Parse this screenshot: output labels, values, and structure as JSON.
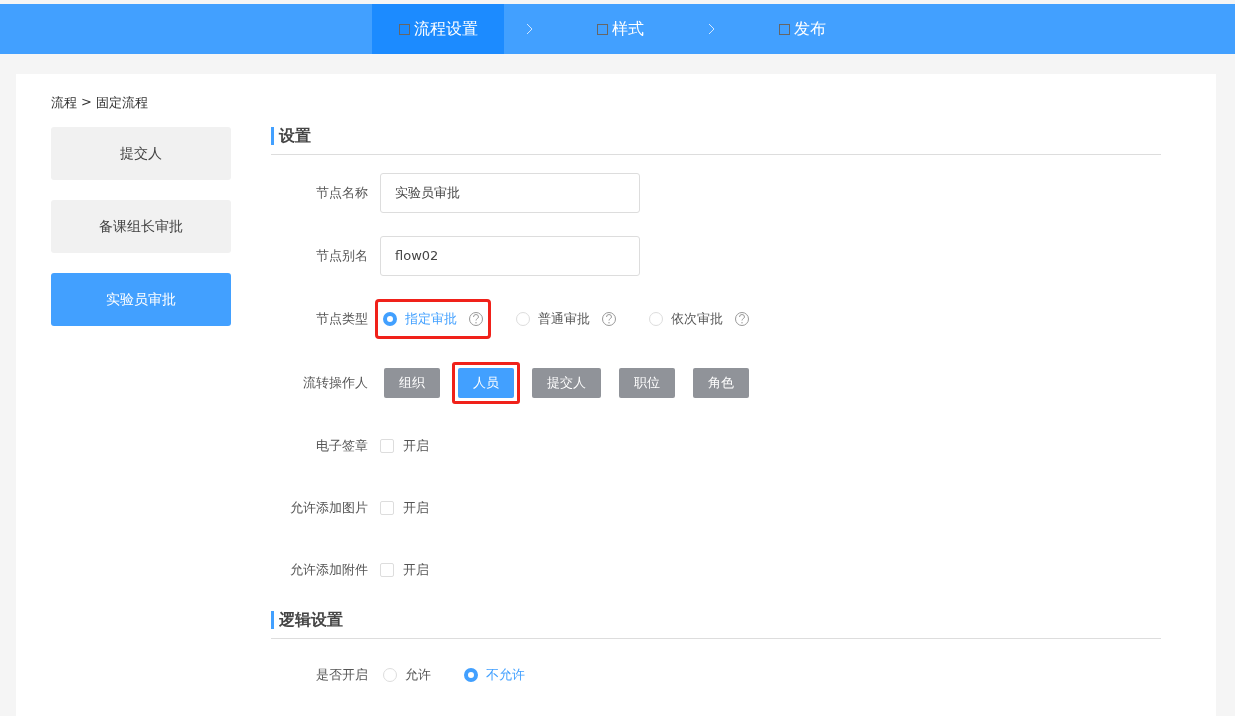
{
  "steps": [
    {
      "label": "流程设置",
      "selected": true
    },
    {
      "label": "样式",
      "selected": false
    },
    {
      "label": "发布",
      "selected": false
    }
  ],
  "breadcrumb": {
    "items": [
      "流程",
      "固定流程"
    ],
    "separator": ">"
  },
  "nodes": [
    {
      "label": "提交人",
      "selected": false
    },
    {
      "label": "备课组长审批",
      "selected": false
    },
    {
      "label": "实验员审批",
      "selected": true
    }
  ],
  "sections": [
    {
      "title": "设置",
      "fields": [
        {
          "kind": "text",
          "label": "节点名称",
          "value": "实验员审批"
        },
        {
          "kind": "text",
          "label": "节点别名",
          "value": "flow02"
        },
        {
          "kind": "radio",
          "label": "节点类型",
          "options": [
            {
              "label": "指定审批",
              "selected": true,
              "help": true,
              "highlighted": true
            },
            {
              "label": "普通审批",
              "selected": false,
              "help": true,
              "highlighted": false
            },
            {
              "label": "依次审批",
              "selected": false,
              "help": true,
              "highlighted": false
            }
          ]
        },
        {
          "kind": "buttons",
          "label": "流转操作人",
          "options": [
            {
              "label": "组织",
              "selected": false,
              "highlighted": false
            },
            {
              "label": "人员",
              "selected": true,
              "highlighted": true
            },
            {
              "label": "提交人",
              "selected": false,
              "highlighted": false
            },
            {
              "label": "职位",
              "selected": false,
              "highlighted": false
            },
            {
              "label": "角色",
              "selected": false,
              "highlighted": false
            }
          ]
        },
        {
          "kind": "checkbox",
          "label": "电子签章",
          "option": "开启",
          "checked": false
        },
        {
          "kind": "checkbox",
          "label": "允许添加图片",
          "option": "开启",
          "checked": false
        },
        {
          "kind": "checkbox",
          "label": "允许添加附件",
          "option": "开启",
          "checked": false
        }
      ]
    },
    {
      "title": "逻辑设置",
      "fields": [
        {
          "kind": "radio",
          "label": "是否开启",
          "options": [
            {
              "label": "允许",
              "selected": false,
              "help": false,
              "highlighted": false
            },
            {
              "label": "不允许",
              "selected": true,
              "help": false,
              "highlighted": false
            }
          ]
        }
      ]
    }
  ]
}
